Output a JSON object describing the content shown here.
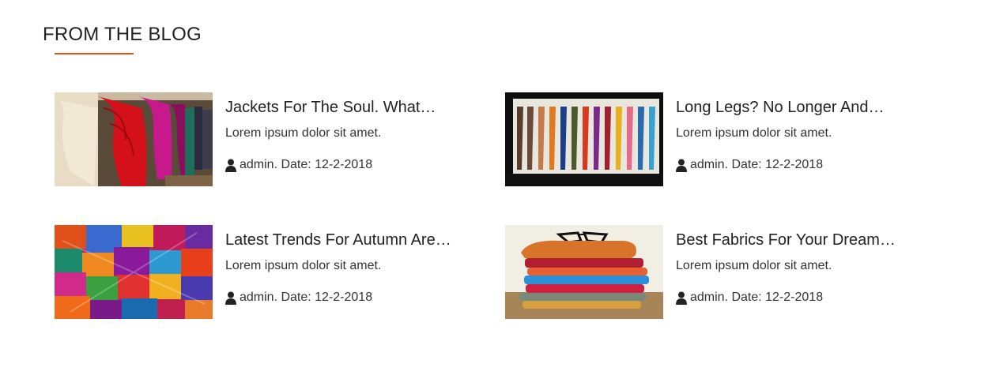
{
  "section": {
    "title": "FROM THE BLOG",
    "accent_color": "#e2501c"
  },
  "posts": [
    {
      "title": "Jackets For The Soul. What…",
      "excerpt": "Lorem ipsum dolor sit amet.",
      "meta": "admin. Date: 12-2-2018",
      "image": "puffer-jackets-rack"
    },
    {
      "title": "Long Legs? No Longer And…",
      "excerpt": "Lorem ipsum dolor sit amet.",
      "meta": "admin. Date: 12-2-2018",
      "image": "colored-tights-display"
    },
    {
      "title": "Latest Trends For Autumn Are…",
      "excerpt": "Lorem ipsum dolor sit amet.",
      "meta": "admin. Date: 12-2-2018",
      "image": "colorful-scarves"
    },
    {
      "title": "Best Fabrics For Your Dream…",
      "excerpt": "Lorem ipsum dolor sit amet.",
      "meta": "admin. Date: 12-2-2018",
      "image": "folded-shirts-with-glasses"
    }
  ]
}
